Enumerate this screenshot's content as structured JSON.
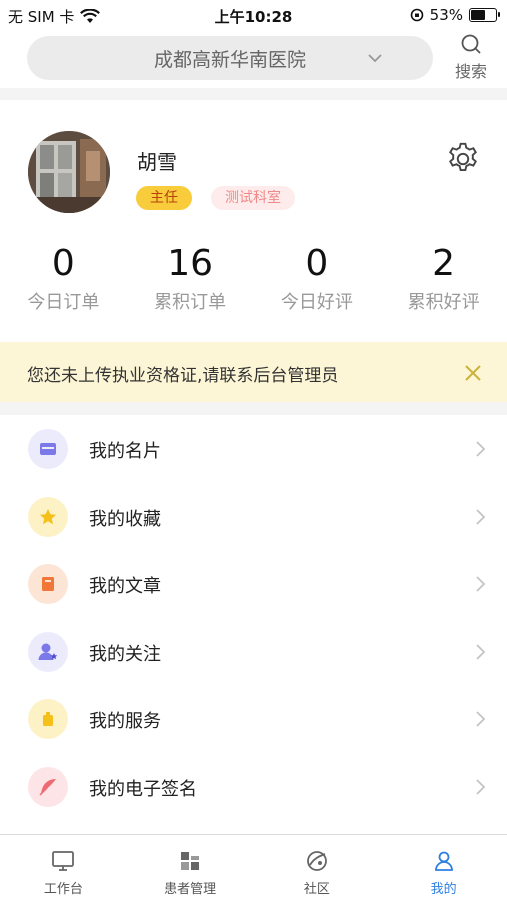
{
  "status_bar": {
    "carrier": "无 SIM 卡",
    "time": "上午10:28",
    "battery": "53%",
    "battery_level": 0.53
  },
  "header": {
    "hospital": "成都高新华南医院",
    "search_label": "搜索"
  },
  "profile": {
    "name": "胡雪",
    "role": "主任",
    "department": "测试科室"
  },
  "stats": [
    {
      "value": "0",
      "label": "今日订单"
    },
    {
      "value": "16",
      "label": "累积订单"
    },
    {
      "value": "0",
      "label": "今日好评"
    },
    {
      "value": "2",
      "label": "累积好评"
    }
  ],
  "notice": {
    "text": "您还未上传执业资格证,请联系后台管理员"
  },
  "menu": [
    {
      "label": "我的名片",
      "icon": "card-icon",
      "bg": "#ecebfb",
      "color": "#7b78e8"
    },
    {
      "label": "我的收藏",
      "icon": "star-icon",
      "bg": "#fdf2c6",
      "color": "#f5c01a"
    },
    {
      "label": "我的文章",
      "icon": "book-icon",
      "bg": "#fde5d6",
      "color": "#f27638"
    },
    {
      "label": "我的关注",
      "icon": "user-star-icon",
      "bg": "#ecebfb",
      "color": "#7b78e8"
    },
    {
      "label": "我的服务",
      "icon": "bag-icon",
      "bg": "#fdf2c6",
      "color": "#f5c01a"
    },
    {
      "label": "我的电子签名",
      "icon": "feather-icon",
      "bg": "#fde4e6",
      "color": "#ef6b74"
    }
  ],
  "tabs": [
    {
      "label": "工作台",
      "icon": "monitor-icon",
      "active": false
    },
    {
      "label": "患者管理",
      "icon": "grid-icon",
      "active": false
    },
    {
      "label": "社区",
      "icon": "planet-icon",
      "active": false
    },
    {
      "label": "我的",
      "icon": "person-icon",
      "active": true
    }
  ],
  "colors": {
    "accent": "#2f7fe3",
    "role_badge_bg": "#f8cc3a",
    "dept_badge_bg": "#fdeceb",
    "notice_bg": "#fdf6d6"
  }
}
